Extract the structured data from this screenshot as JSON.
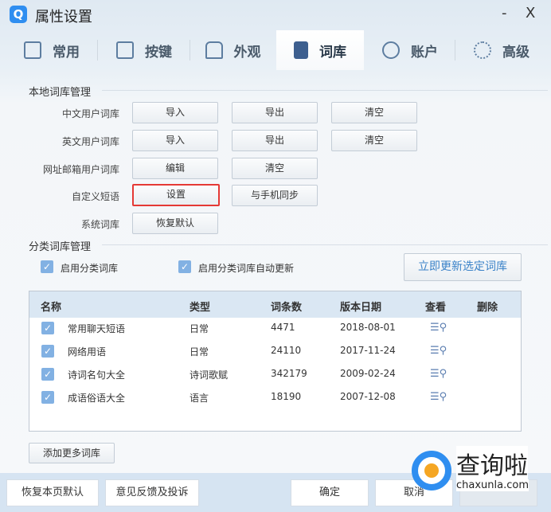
{
  "window": {
    "title": "属性设置",
    "minimize": "-",
    "close": "X"
  },
  "tabs": [
    {
      "label": "常用",
      "icon": "monitor-icon"
    },
    {
      "label": "按键",
      "icon": "key-icon"
    },
    {
      "label": "外观",
      "icon": "tshirt-icon"
    },
    {
      "label": "词库",
      "icon": "book-icon",
      "active": true
    },
    {
      "label": "账户",
      "icon": "user-icon"
    },
    {
      "label": "高级",
      "icon": "gear-icon"
    }
  ],
  "local": {
    "title": "本地词库管理",
    "rows": [
      {
        "label": "中文用户词库",
        "buttons": [
          "导入",
          "导出",
          "清空"
        ]
      },
      {
        "label": "英文用户词库",
        "buttons": [
          "导入",
          "导出",
          "清空"
        ]
      },
      {
        "label": "网址邮箱用户词库",
        "buttons": [
          "编辑",
          "清空"
        ]
      },
      {
        "label": "自定义短语",
        "buttons": [
          "设置",
          "与手机同步"
        ]
      },
      {
        "label": "系统词库",
        "buttons": [
          "恢复默认"
        ]
      }
    ]
  },
  "category": {
    "title": "分类词库管理",
    "enable": "启用分类词库",
    "auto_update": "启用分类词库自动更新",
    "update_now": "立即更新选定词库",
    "columns": [
      "名称",
      "类型",
      "词条数",
      "版本日期",
      "查看",
      "删除"
    ],
    "rows": [
      {
        "name": "常用聊天短语",
        "type": "日常",
        "count": "4471",
        "date": "2018-08-01"
      },
      {
        "name": "网络用语",
        "type": "日常",
        "count": "24110",
        "date": "2017-11-24"
      },
      {
        "name": "诗词名句大全",
        "type": "诗词歌赋",
        "count": "342179",
        "date": "2009-02-24"
      },
      {
        "name": "成语俗语大全",
        "type": "语言",
        "count": "18190",
        "date": "2007-12-08"
      }
    ],
    "add_more": "添加更多词库"
  },
  "footer": {
    "restore": "恢复本页默认",
    "feedback": "意见反馈及投诉",
    "ok": "确定",
    "cancel": "取消"
  },
  "watermark": {
    "name": "查询啦",
    "url": "chaxunla.com"
  },
  "colors": {
    "accent": "#2f8ef0",
    "highlight": "#e53935",
    "checkbox": "#82b1e3"
  }
}
